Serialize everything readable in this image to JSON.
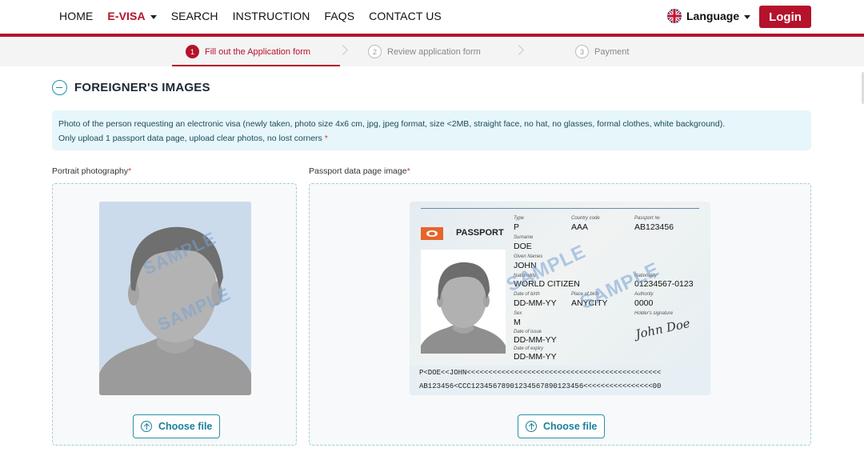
{
  "nav": {
    "items": [
      "HOME",
      "E-VISA",
      "SEARCH",
      "INSTRUCTION",
      "FAQS",
      "CONTACT US"
    ],
    "active": "E-VISA",
    "language_label": "Language",
    "login_label": "Login",
    "accent_color": "#b5122b"
  },
  "stepper": {
    "steps": [
      {
        "num": "1",
        "label": "Fill out the Application form",
        "active": true
      },
      {
        "num": "2",
        "label": "Review application form",
        "active": false
      },
      {
        "num": "3",
        "label": "Payment",
        "active": false
      }
    ]
  },
  "section": {
    "title": "FOREIGNER'S IMAGES",
    "info_line1": "Photo of the person requesting an electronic visa (newly taken, photo size 4x6 cm, jpg, jpeg format, size <2MB, straight face, no hat, no glasses, formal clothes, white background).",
    "info_line2": "Only upload 1 passport data page, upload clear photos, no lost corners",
    "required_mark": "*"
  },
  "portrait": {
    "label": "Portrait photography",
    "watermark": "SAMPLE",
    "button_label": "Choose file"
  },
  "passport": {
    "label": "Passport data page image",
    "button_label": "Choose file",
    "heading": "PASSPORT",
    "watermark": "SAMPLE",
    "fields": {
      "type_label": "Type",
      "type": "P",
      "country_label": "Country code",
      "country": "AAA",
      "passport_no_label": "Passport №",
      "passport_no": "AB123456",
      "surname_label": "Surname",
      "surname": "DOE",
      "given_label": "Given Names",
      "given": "JOHN",
      "nationality_label": "Nationality",
      "nationality": "WORLD CITIZEN",
      "personal_no_label": "Nationality",
      "personal_no": "01234567-0123",
      "dob_label": "Date of birth",
      "dob": "DD-MM-YY",
      "pob_label": "Place of birth",
      "pob": "ANYCITY",
      "authority_label": "Authority",
      "authority": "0000",
      "signature_label": "Holder's signature",
      "sex_label": "Sex",
      "sex": "M",
      "issue_label": "Date of issue",
      "issue": "DD-MM-YY",
      "expiry_label": "Date of expiry",
      "expiry": "DD-MM-YY",
      "signature": "John Doe"
    },
    "mrz1": "P<DOE<<JOHN<<<<<<<<<<<<<<<<<<<<<<<<<<<<<<<<<<<<<<<<<<<<<",
    "mrz2": "AB123456<CCC12345678901234567890123456<<<<<<<<<<<<<<<<00"
  }
}
